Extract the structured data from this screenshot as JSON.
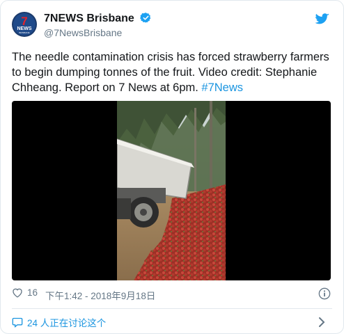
{
  "account": {
    "display_name": "7NEWS Brisbane",
    "handle": "@7NewsBrisbane",
    "logo_number": "7",
    "logo_text": "NEWS",
    "logo_subtext": "BRISBANE"
  },
  "tweet": {
    "text": "The needle contamination crisis has forced strawberry farmers to begin dumping tonnes of the fruit. Video credit: Stephanie Chheang. Report on 7 News at 6pm. ",
    "hashtag": "#7News"
  },
  "footer": {
    "likes": "16",
    "timestamp": "下午1:42 - 2018年9月18日"
  },
  "discussion": {
    "label": "24 人正在讨论这个"
  },
  "colors": {
    "twitter_blue": "#1da1f2",
    "link_blue": "#1b95e0",
    "logo_red": "#e3242b",
    "logo_navy": "#1b3a6b"
  },
  "icons": [
    "seven-news-logo",
    "verified-badge-icon",
    "twitter-bird-icon",
    "heart-icon",
    "info-icon",
    "comment-bubble-icon",
    "chevron-right-icon"
  ]
}
